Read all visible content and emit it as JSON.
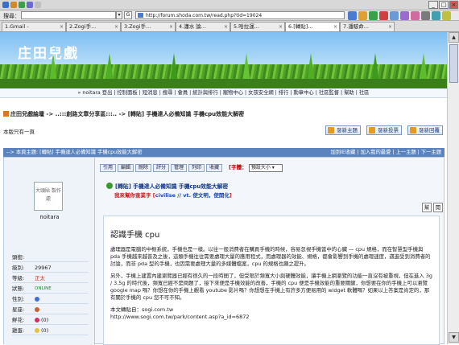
{
  "browser": {
    "search_label": "搜尋：",
    "search_button": "G",
    "address": "http://forum.shoda.com.tw/read.php?tid=19024",
    "tabs": [
      {
        "label": "1.Gmail -"
      },
      {
        "label": "2.Zogi手..."
      },
      {
        "label": "3.Zogi手..."
      },
      {
        "label": "4.瀟水 論..."
      },
      {
        "label": "5.哈拉運..."
      },
      {
        "label": "6.[轉貼]..."
      },
      {
        "label": "7.潘駭命..."
      }
    ]
  },
  "site": {
    "title": "庄田兒戲"
  },
  "nav": {
    "text": "» noitara 登出 | 控制面板 | 短消息 | 搜尋 | 會員 | 統計與排行 | 寵物中心 | 女孩安全網 | 排行 | 勳章中心 | 社區監督 | 幫助 | 社區"
  },
  "breadcrumb": {
    "text": "庄田兒戲論壇 -> ..:::創路文章分享區:::.. -> [轉貼] 手機達人必備知識 手機cpu效能大解密"
  },
  "hint": "本版只有一頁",
  "actions": {
    "new_topic": "發新主題",
    "new_poll": "發新投票",
    "reply": "發新回覆"
  },
  "topic_bar": {
    "left": "--> 本頁主題: [轉貼] 手機達人必備知識 手機cpu效能大解密",
    "right": "加到IE收藏 | 加入我的最愛 | 上一主題 | 下一主題"
  },
  "user": {
    "avatar_text": "大頭貼 製作處",
    "name": "noitara",
    "stats": [
      {
        "label": "頭銜:",
        "value": ""
      },
      {
        "label": "級別:",
        "value": "29967"
      },
      {
        "label": "等級:",
        "value": "正太"
      },
      {
        "label": "狀態:",
        "value": "ONLINE"
      },
      {
        "label": "性別:",
        "value": ""
      },
      {
        "label": "星座:",
        "value": ""
      },
      {
        "label": "鮮花:",
        "value": "(0)"
      },
      {
        "label": "雞蛋:",
        "value": "(0)"
      }
    ]
  },
  "post": {
    "tools": [
      "引用",
      "編輯",
      "刪除",
      "評分",
      "管理",
      "列印",
      "收藏"
    ],
    "font_label": "[字體：",
    "font_value": "預設大小",
    "title": "[轉貼] 手機達人必備知識  手機cpu效能大解密",
    "subtitle_pre": "我來幫你查業字 [",
    "subtitle_tags": "civilise // vt. 使文明，使開化",
    "subtitle_post": "]",
    "btn_a": "幫",
    "btn_b": "閱",
    "heading": "認識手機 cpu",
    "para1": "處理器是電腦的中樞系統，手機也是一樣。以往一般消費者在購買手機的時候，容易忽視手機當中的心臟 — cpu 規格，而在智慧型手機與 pda 手機越來越普及之後，這類手機往往需要處理大量的應用程式，而處理器的效能、規格，都會影響到手機的處理速度，邁進受到消費者的討論，而非 pda 型的手機，也因需要處理大量的多媒體檔案，cpu 的規格也顯之提升。",
    "para2": "另外，手機上建置內建瀏覽器已經有很久的一段時間了，但受限於頻寬大小與硬體效能，讓手機上網瀏覽的功能一直沒有被重視，但在進入 3g / 3.5g 的時代後，頻寬已經不是問題了，接下來便是手機效能的改善，手機的 cpu 便是手機效能的重要關鍵，你想要在你的手機上可以瀏覽 google map 嗎？你想在你的手機上觀看 youtube 影片嗎？你想想在手機上有許多方便易用的 widget 軟體嗎？如果以上答案是肯定的，那有關於手機的 cpu 您不可不知。",
    "source_label": "本文轉貼自：sogi.com.tw",
    "source_url": "http://www.sogi.com.tw/park/content.asp?a_id=6872"
  }
}
